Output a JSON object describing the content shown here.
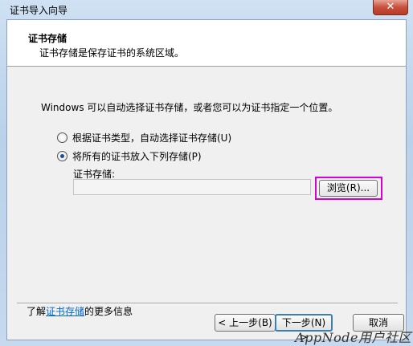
{
  "window": {
    "title": "证书导入向导",
    "close_label": "✕"
  },
  "header": {
    "title": "证书存储",
    "description": "证书存储是保存证书的系统区域。"
  },
  "main": {
    "intro": "Windows 可以自动选择证书存储，或者您可以为证书指定一个位置。",
    "options": [
      {
        "label": "根据证书类型，自动选择证书存储(U)",
        "checked": false
      },
      {
        "label": "将所有的证书放入下列存储(P)",
        "checked": true
      }
    ],
    "store_label": "证书存储:",
    "store_value": "",
    "browse_label": "浏览(R)..."
  },
  "learn_more": {
    "prefix": "了解",
    "link": "证书存储",
    "suffix": "的更多信息"
  },
  "footer": {
    "back_label": "< 上一步(B)",
    "next_label": "下一步(N) >",
    "cancel_label": "取消"
  },
  "watermark": "AppNode用户社区",
  "colors": {
    "highlight": "#d400d4",
    "link": "#0066cc"
  }
}
